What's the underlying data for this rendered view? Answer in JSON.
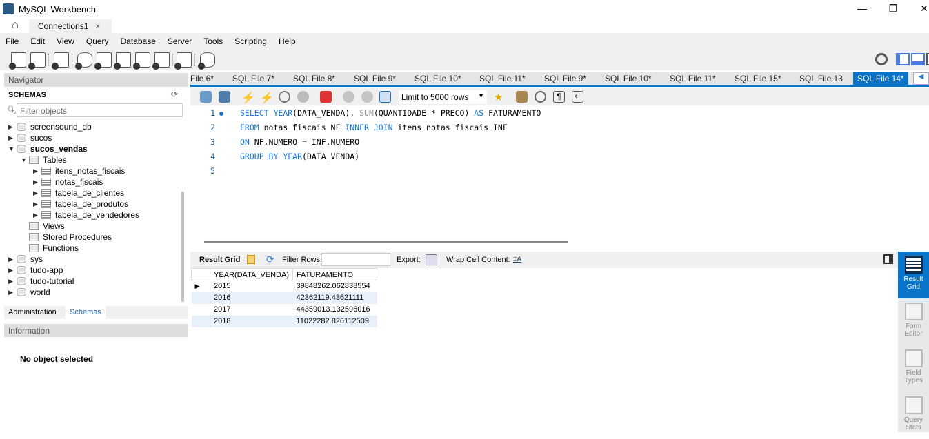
{
  "window": {
    "title": "MySQL Workbench",
    "controls": [
      "—",
      "❐",
      "✕"
    ]
  },
  "connection_tab": {
    "label": "Connections1",
    "close": "×"
  },
  "menu": [
    "File",
    "Edit",
    "View",
    "Query",
    "Database",
    "Server",
    "Tools",
    "Scripting",
    "Help"
  ],
  "navigator": {
    "header": "Navigator",
    "schemas_title": "SCHEMAS",
    "filter_placeholder": "Filter objects",
    "tree": [
      {
        "label": "screensound_db",
        "level": 0,
        "arrow": "▶",
        "icon": "database",
        "bold": false
      },
      {
        "label": "sucos",
        "level": 0,
        "arrow": "▶",
        "icon": "database",
        "bold": false
      },
      {
        "label": "sucos_vendas",
        "level": 0,
        "arrow": "▼",
        "icon": "database",
        "bold": true
      },
      {
        "label": "Tables",
        "level": 1,
        "arrow": "▼",
        "icon": "folder",
        "bold": false
      },
      {
        "label": "itens_notas_fiscais",
        "level": 2,
        "arrow": "▶",
        "icon": "table",
        "bold": false
      },
      {
        "label": "notas_fiscais",
        "level": 2,
        "arrow": "▶",
        "icon": "table",
        "bold": false
      },
      {
        "label": "tabela_de_clientes",
        "level": 2,
        "arrow": "▶",
        "icon": "table",
        "bold": false
      },
      {
        "label": "tabela_de_produtos",
        "level": 2,
        "arrow": "▶",
        "icon": "table",
        "bold": false
      },
      {
        "label": "tabela_de_vendedores",
        "level": 2,
        "arrow": "▶",
        "icon": "table",
        "bold": false
      },
      {
        "label": "Views",
        "level": 1,
        "arrow": "",
        "icon": "folder",
        "bold": false
      },
      {
        "label": "Stored Procedures",
        "level": 1,
        "arrow": "",
        "icon": "folder",
        "bold": false
      },
      {
        "label": "Functions",
        "level": 1,
        "arrow": "",
        "icon": "folder",
        "bold": false
      },
      {
        "label": "sys",
        "level": 0,
        "arrow": "▶",
        "icon": "database",
        "bold": false
      },
      {
        "label": "tudo-app",
        "level": 0,
        "arrow": "▶",
        "icon": "database",
        "bold": false
      },
      {
        "label": "tudo-tutorial",
        "level": 0,
        "arrow": "▶",
        "icon": "database",
        "bold": false
      },
      {
        "label": "world",
        "level": 0,
        "arrow": "▶",
        "icon": "database",
        "bold": false
      }
    ],
    "tabs": [
      "Administration",
      "Schemas"
    ],
    "active_tab": "Schemas"
  },
  "information": {
    "header": "Information",
    "message": "No object selected"
  },
  "sql_tabs": [
    "File 6*",
    "SQL File 7*",
    "SQL File 8*",
    "SQL File 9*",
    "SQL File 10*",
    "SQL File 11*",
    "SQL File 9*",
    "SQL File 10*",
    "SQL File 11*",
    "SQL File 15*",
    "SQL File 13",
    "SQL File 14*"
  ],
  "active_sql_tab": "SQL File 14*",
  "editor_toolbar": {
    "limit": "Limit to 5000 rows"
  },
  "editor": {
    "lines": [
      [
        [
          "kw",
          "SELECT "
        ],
        [
          "kw",
          "YEAR"
        ],
        [
          "t",
          "(DATA_VENDA), "
        ],
        [
          "fn",
          "SUM"
        ],
        [
          "t",
          "(QUANTIDADE * PRECO) "
        ],
        [
          "kw",
          "AS"
        ],
        [
          "t",
          " FATURAMENTO"
        ]
      ],
      [
        [
          "kw",
          "FROM"
        ],
        [
          "t",
          " notas_fiscais NF "
        ],
        [
          "kw",
          "INNER JOIN"
        ],
        [
          "t",
          " itens_notas_fiscais INF"
        ]
      ],
      [
        [
          "kw",
          "ON"
        ],
        [
          "t",
          " NF.NUMERO = INF.NUMERO"
        ]
      ],
      [
        [
          "kw",
          "GROUP BY "
        ],
        [
          "kw",
          "YEAR"
        ],
        [
          "t",
          "(DATA_VENDA)"
        ]
      ],
      []
    ]
  },
  "result_toolbar": {
    "result_grid": "Result Grid",
    "filter_rows": "Filter Rows:",
    "filter_value": "",
    "export": "Export:",
    "wrap": "Wrap Cell Content:"
  },
  "result": {
    "columns": [
      "YEAR(DATA_VENDA)",
      "FATURAMENTO"
    ],
    "rows": [
      [
        "2015",
        "39848262.062838554"
      ],
      [
        "2016",
        "42362119.43621111"
      ],
      [
        "2017",
        "44359013.132596016"
      ],
      [
        "2018",
        "11022282.826112509"
      ]
    ]
  },
  "side_panel": [
    {
      "label": "Result Grid",
      "active": true
    },
    {
      "label": "Form Editor",
      "active": false
    },
    {
      "label": "Field Types",
      "active": false
    },
    {
      "label": "Query Stats",
      "active": false
    }
  ],
  "colors": {
    "accent": "#0a74c9",
    "keyword": "#1976d2"
  }
}
